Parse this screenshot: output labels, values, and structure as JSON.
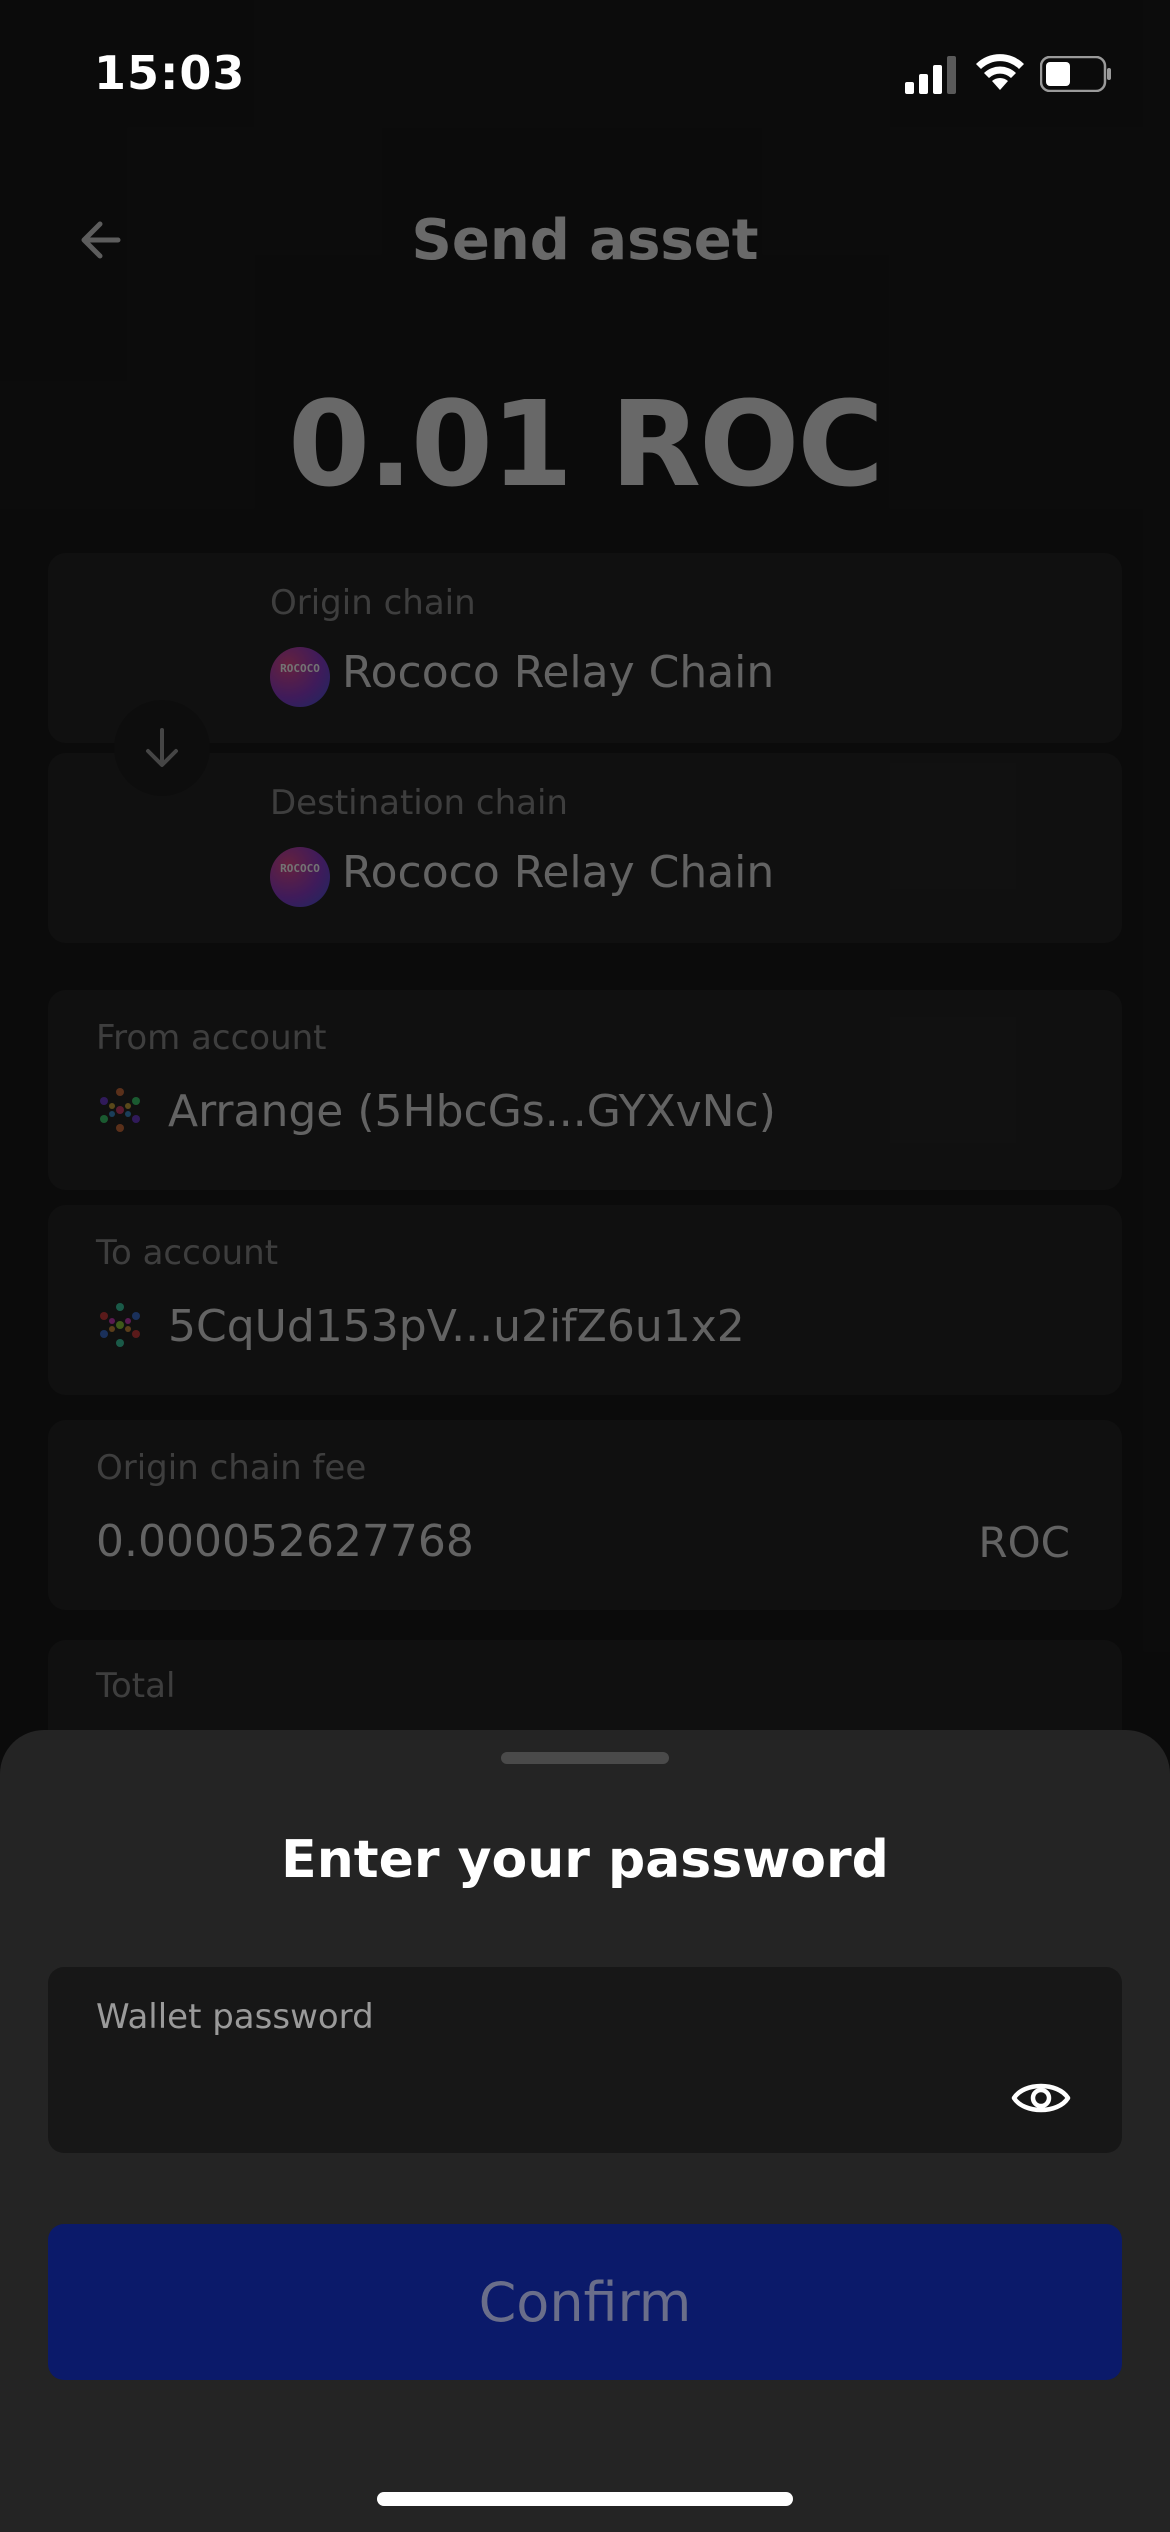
{
  "status": {
    "time": "15:03"
  },
  "nav": {
    "title": "Send asset"
  },
  "amount": "0.01 ROC",
  "origin": {
    "label": "Origin chain",
    "chain": "Rococo Relay Chain",
    "icon_text": "ROCOCO"
  },
  "destination": {
    "label": "Destination chain",
    "chain": "Rococo Relay Chain",
    "icon_text": "ROCOCO"
  },
  "from_account": {
    "label": "From account",
    "value": "Arrange (5HbcGs...GYXvNc)"
  },
  "to_account": {
    "label": "To account",
    "value": "5CqUd153pV...u2ifZ6u1x2"
  },
  "fee": {
    "label": "Origin chain fee",
    "value": "0.000052627768",
    "unit": "ROC"
  },
  "total": {
    "label": "Total"
  },
  "sheet": {
    "title": "Enter your password",
    "password_label": "Wallet password",
    "password_value": "",
    "confirm_label": "Confirm"
  },
  "colors": {
    "accent": "#0b1a6a",
    "background": "#1a1a1a",
    "sheet": "#242424"
  }
}
